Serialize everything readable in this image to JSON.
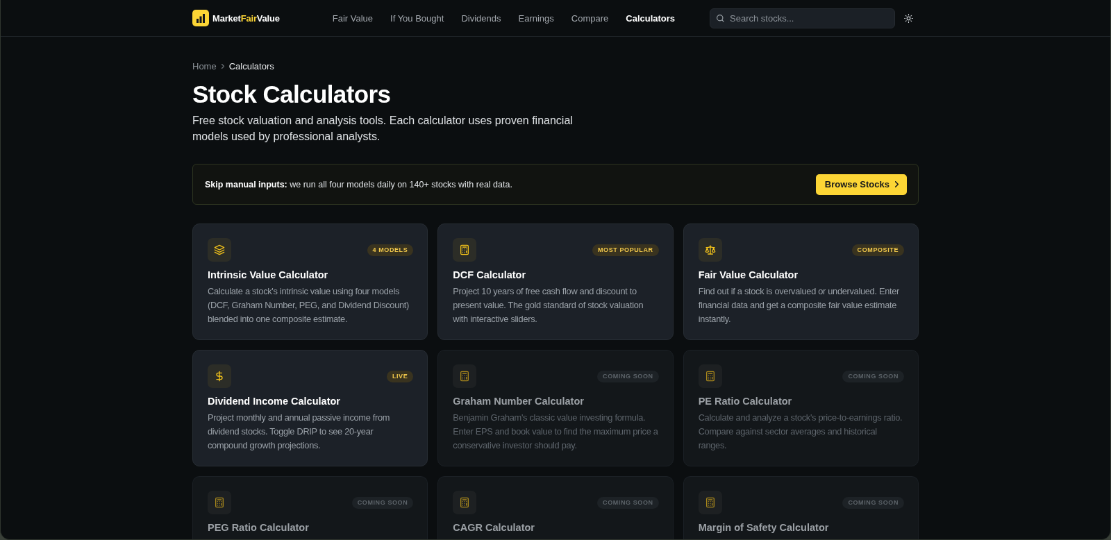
{
  "header": {
    "logo": {
      "parts": [
        {
          "text": "Market",
          "highlight": false
        },
        {
          "text": "Fair",
          "highlight": true
        },
        {
          "text": "Value",
          "highlight": false
        }
      ]
    },
    "nav": [
      {
        "label": "Fair Value",
        "selected": false
      },
      {
        "label": "If You Bought",
        "selected": false
      },
      {
        "label": "Dividends",
        "selected": false
      },
      {
        "label": "Earnings",
        "selected": false
      },
      {
        "label": "Compare",
        "selected": false
      },
      {
        "label": "Calculators",
        "selected": true
      }
    ],
    "search": {
      "placeholder": "Search stocks..."
    }
  },
  "breadcrumb": [
    {
      "label": "Home",
      "current": false
    },
    {
      "label": "Calculators",
      "current": true
    }
  ],
  "title": "Stock Calculators",
  "subtitle": "Free stock valuation and analysis tools. Each calculator uses proven financial models used by professional analysts.",
  "banner": {
    "text": "**Skip manual inputs:** we run all four models daily on 140+ stocks with real data.",
    "button": "Browse Stocks"
  },
  "cards": [
    {
      "title": "Intrinsic Value Calculator",
      "description": "Calculate a stock's intrinsic value using four models (DCF, Graham Number, PEG, and Dividend Discount) blended into one composite estimate.",
      "badge": "4 MODELS",
      "disabled": false
    },
    {
      "title": "DCF Calculator",
      "description": "Project 10 years of free cash flow and discount to present value. The gold standard of stock valuation with interactive sliders.",
      "badge": "MOST POPULAR",
      "disabled": false
    },
    {
      "title": "Fair Value Calculator",
      "description": "Find out if a stock is overvalued or undervalued. Enter financial data and get a composite fair value estimate instantly.",
      "badge": "COMPOSITE",
      "disabled": false
    },
    {
      "title": "Dividend Income Calculator",
      "description": "Project monthly and annual passive income from dividend stocks. Toggle DRIP to see 20-year compound growth projections.",
      "badge": "LIVE",
      "disabled": false
    },
    {
      "title": "Graham Number Calculator",
      "description": "Benjamin Graham's classic value investing formula. Enter EPS and book value to find the maximum price a conservative investor should pay.",
      "badge": "COMING SOON",
      "disabled": true
    },
    {
      "title": "PE Ratio Calculator",
      "description": "Calculate and analyze a stock's price-to-earnings ratio. Compare against sector averages and historical ranges.",
      "badge": "COMING SOON",
      "disabled": true
    },
    {
      "title": "PEG Ratio Calculator",
      "badge": "COMING SOON",
      "disabled": true
    },
    {
      "title": "CAGR Calculator",
      "badge": "COMING SOON",
      "disabled": true
    },
    {
      "title": "Margin of Safety Calculator",
      "badge": "COMING SOON",
      "disabled": true
    }
  ]
}
